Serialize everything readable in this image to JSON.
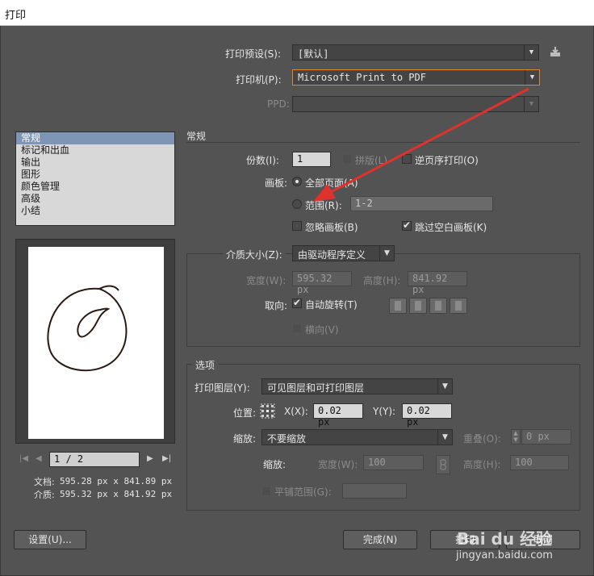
{
  "window": {
    "title": "打印"
  },
  "header": {
    "preset_label": "打印预设(S):",
    "preset_value": "[默认]",
    "printer_label": "打印机(P):",
    "printer_value": "Microsoft Print to PDF",
    "ppd_label": "PPD:",
    "ppd_value": ""
  },
  "sidebar": {
    "items": [
      {
        "label": "常规",
        "selected": true
      },
      {
        "label": "标记和出血"
      },
      {
        "label": "输出"
      },
      {
        "label": "图形"
      },
      {
        "label": "颜色管理"
      },
      {
        "label": "高级"
      },
      {
        "label": "小结"
      }
    ]
  },
  "preview": {
    "page_indicator": "1 / 2",
    "doc_label": "文档:",
    "doc_size": "595.28 px x 841.89 px",
    "media_label": "介质:",
    "media_size": "595.32 px x 841.92 px"
  },
  "general": {
    "section_title": "常规",
    "copies_label": "份数(I):",
    "copies_value": "1",
    "collate_label": "拼版(L)",
    "reverse_label": "逆页序打印(O)",
    "artboard_label": "画板:",
    "all_pages_label": "全部页面(A)",
    "range_label": "范围(R):",
    "range_value": "1-2",
    "ignore_artboards_label": "忽略画板(B)",
    "skip_blank_label": "跳过空白画板(K)"
  },
  "media": {
    "size_label": "介质大小(Z):",
    "size_value": "由驱动程序定义",
    "width_label": "宽度(W):",
    "width_value": "595.32 px",
    "height_label": "高度(H):",
    "height_value": "841.92 px",
    "orientation_label": "取向:",
    "auto_rotate_label": "自动旋转(T)",
    "transverse_label": "横向(V)"
  },
  "options": {
    "section_title": "选项",
    "layers_label": "打印图层(Y):",
    "layers_value": "可见图层和可打印图层",
    "placement_label": "位置:",
    "x_label": "X(X):",
    "x_value": "0.02 px",
    "y_label": "Y(Y):",
    "y_value": "0.02 px",
    "scaling_label": "缩放:",
    "scaling_value": "不要缩放",
    "overlap_label": "重叠(O):",
    "overlap_value": "0 px",
    "scale_label": "缩放:",
    "scale_width_label": "宽度(W):",
    "scale_width_value": "100",
    "scale_height_label": "高度(H):",
    "scale_height_value": "100",
    "tile_range_label": "平铺范围(G):",
    "tile_range_value": ""
  },
  "footer": {
    "setup_label": "设置(U)...",
    "done_label": "完成(N)",
    "print_label": "打印",
    "cancel_label": "取消"
  },
  "watermark": {
    "text": "jingyan.baidu.com",
    "brand": "Bai du 经验"
  },
  "colors": {
    "dialog_bg": "#535353",
    "focus": "#e0882a",
    "annotation_arrow": "#e0322d",
    "list_selection": "#7f95b5"
  }
}
